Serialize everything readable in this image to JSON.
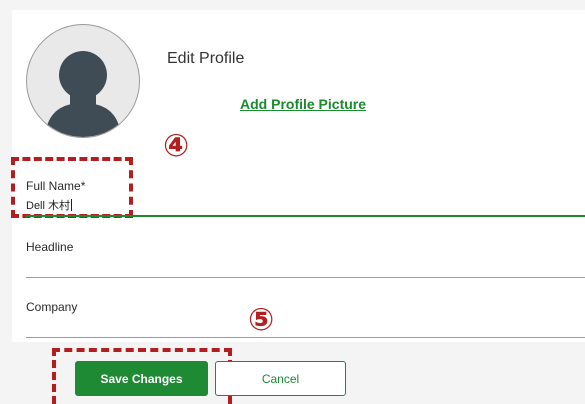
{
  "profile": {
    "title": "Edit Profile",
    "add_picture_link": "Add Profile Picture"
  },
  "annotations": {
    "step_4": "④",
    "step_5": "⑤",
    "color": "#b31e1e"
  },
  "form": {
    "full_name": {
      "label": "Full Name",
      "required_mark": "*",
      "value": "Dell 木村"
    },
    "headline": {
      "label": "Headline",
      "value": ""
    },
    "company": {
      "label": "Company",
      "value": ""
    }
  },
  "actions": {
    "save_label": "Save Changes",
    "cancel_label": "Cancel",
    "accent_color": "#1e8a33"
  }
}
